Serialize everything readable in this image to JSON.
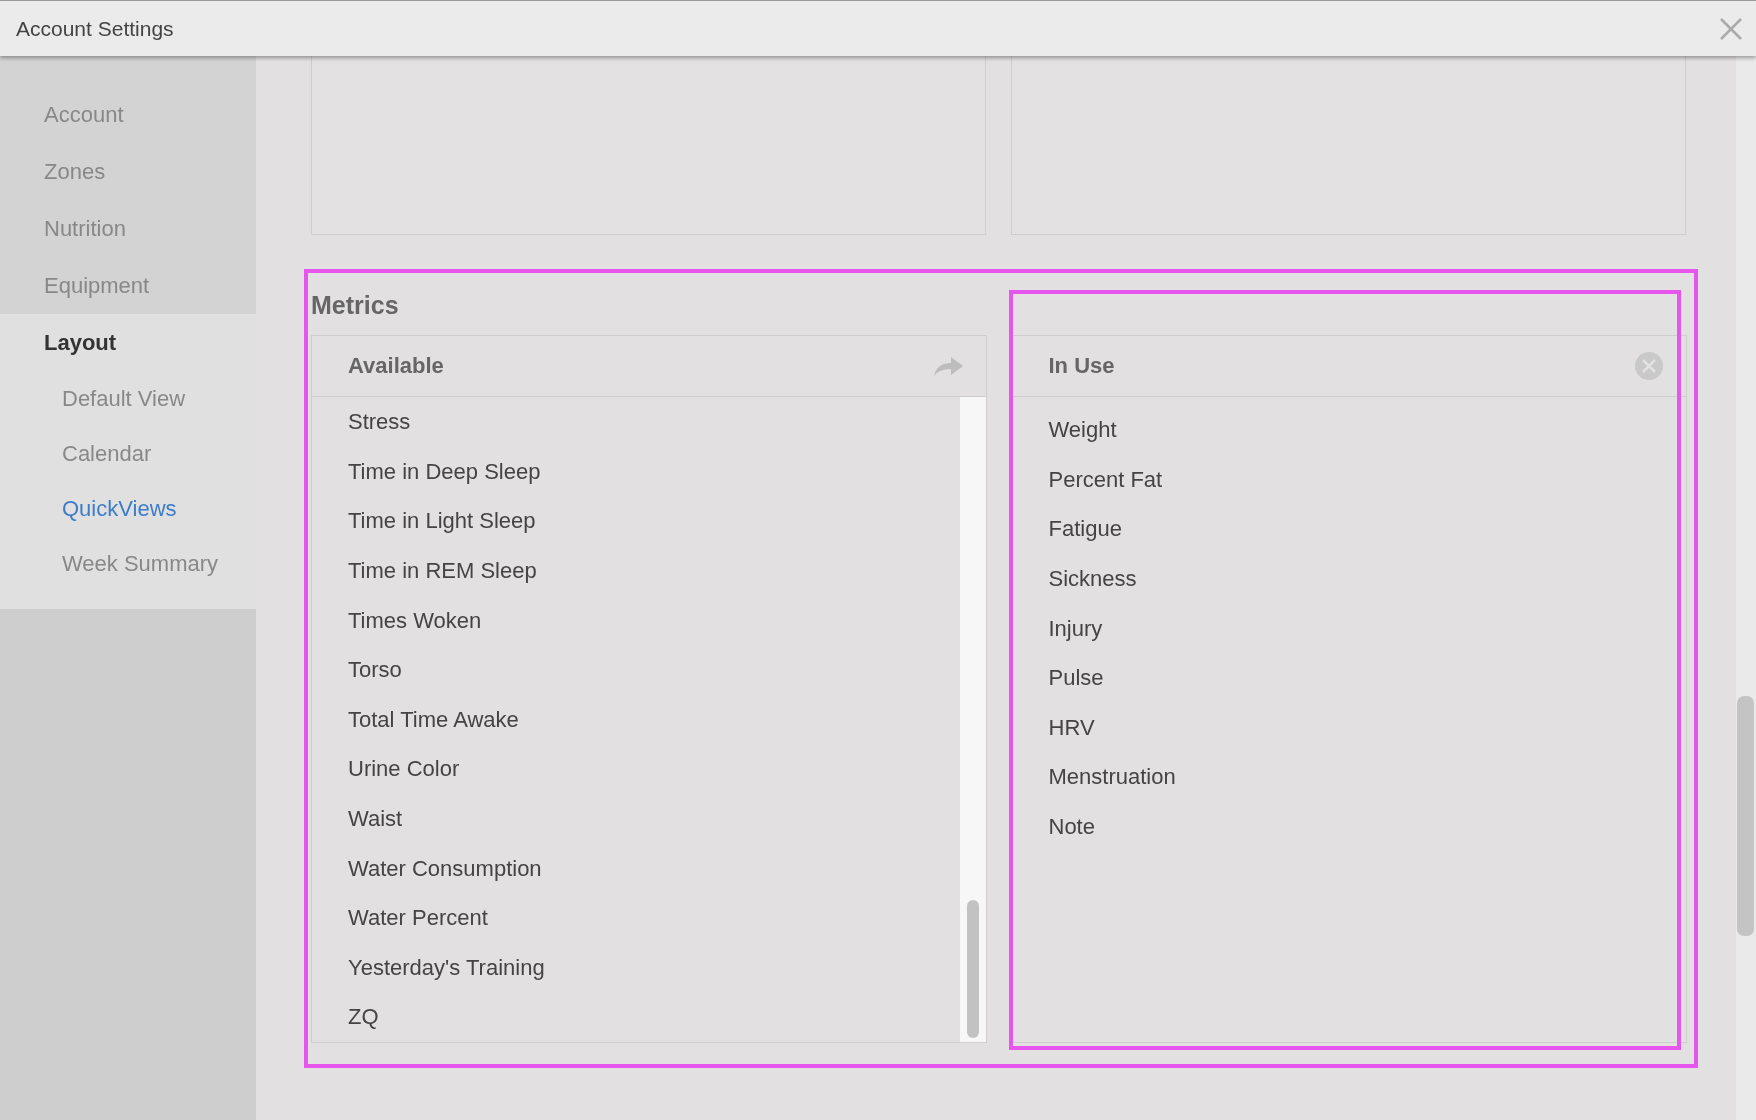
{
  "window": {
    "title": "Account Settings"
  },
  "sidebar": {
    "items": [
      {
        "label": "Account",
        "selected": false
      },
      {
        "label": "Zones",
        "selected": false
      },
      {
        "label": "Nutrition",
        "selected": false
      },
      {
        "label": "Equipment",
        "selected": false
      },
      {
        "label": "Layout",
        "selected": true,
        "children": [
          {
            "label": "Default View",
            "selected": false
          },
          {
            "label": "Calendar",
            "selected": false
          },
          {
            "label": "QuickViews",
            "selected": true
          },
          {
            "label": "Week Summary",
            "selected": false
          }
        ]
      }
    ]
  },
  "metrics": {
    "title": "Metrics",
    "available": {
      "heading": "Available",
      "items": [
        "Stress",
        "Time in Deep Sleep",
        "Time in Light Sleep",
        "Time in REM Sleep",
        "Times Woken",
        "Torso",
        "Total Time Awake",
        "Urine Color",
        "Waist",
        "Water Consumption",
        "Water Percent",
        "Yesterday's Training",
        "ZQ"
      ]
    },
    "in_use": {
      "heading": "In Use",
      "items": [
        "Weight",
        "Percent Fat",
        "Fatigue",
        "Sickness",
        "Injury",
        "Pulse",
        "HRV",
        "Menstruation",
        "Note"
      ]
    }
  }
}
